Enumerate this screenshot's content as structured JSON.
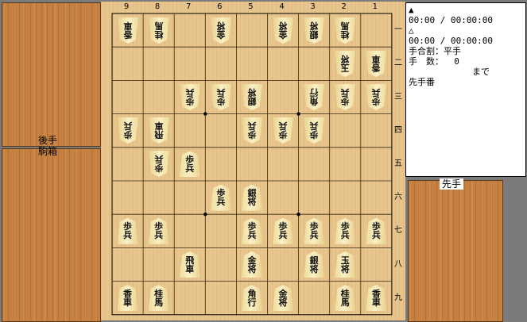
{
  "board": {
    "files": [
      "9",
      "8",
      "7",
      "6",
      "5",
      "4",
      "3",
      "2",
      "1"
    ],
    "ranks": [
      "一",
      "二",
      "三",
      "四",
      "五",
      "六",
      "七",
      "八",
      "九"
    ],
    "hoshi": [
      [
        3,
        3
      ],
      [
        6,
        3
      ],
      [
        3,
        6
      ],
      [
        6,
        6
      ]
    ],
    "pieces": [
      {
        "file": 9,
        "rank": 1,
        "text": "香車",
        "side": "gote"
      },
      {
        "file": 8,
        "rank": 1,
        "text": "桂馬",
        "side": "gote"
      },
      {
        "file": 6,
        "rank": 1,
        "text": "金将",
        "side": "gote"
      },
      {
        "file": 4,
        "rank": 1,
        "text": "金将",
        "side": "gote"
      },
      {
        "file": 3,
        "rank": 1,
        "text": "銀将",
        "side": "gote"
      },
      {
        "file": 2,
        "rank": 1,
        "text": "桂馬",
        "side": "gote"
      },
      {
        "file": 2,
        "rank": 2,
        "text": "玉将",
        "side": "gote"
      },
      {
        "file": 1,
        "rank": 2,
        "text": "香車",
        "side": "gote"
      },
      {
        "file": 7,
        "rank": 3,
        "text": "歩兵",
        "side": "gote"
      },
      {
        "file": 6,
        "rank": 3,
        "text": "歩兵",
        "side": "gote"
      },
      {
        "file": 5,
        "rank": 3,
        "text": "銀将",
        "side": "gote"
      },
      {
        "file": 3,
        "rank": 3,
        "text": "角行",
        "side": "gote"
      },
      {
        "file": 2,
        "rank": 3,
        "text": "歩兵",
        "side": "gote"
      },
      {
        "file": 1,
        "rank": 3,
        "text": "歩兵",
        "side": "gote"
      },
      {
        "file": 9,
        "rank": 4,
        "text": "歩兵",
        "side": "gote"
      },
      {
        "file": 8,
        "rank": 4,
        "text": "飛車",
        "side": "gote"
      },
      {
        "file": 5,
        "rank": 4,
        "text": "歩兵",
        "side": "gote"
      },
      {
        "file": 4,
        "rank": 4,
        "text": "歩兵",
        "side": "gote"
      },
      {
        "file": 3,
        "rank": 4,
        "text": "歩兵",
        "side": "gote"
      },
      {
        "file": 8,
        "rank": 5,
        "text": "歩兵",
        "side": "gote"
      },
      {
        "file": 7,
        "rank": 5,
        "text": "歩兵",
        "side": "sente"
      },
      {
        "file": 6,
        "rank": 6,
        "text": "歩兵",
        "side": "sente"
      },
      {
        "file": 5,
        "rank": 6,
        "text": "銀将",
        "side": "sente"
      },
      {
        "file": 9,
        "rank": 7,
        "text": "歩兵",
        "side": "sente"
      },
      {
        "file": 8,
        "rank": 7,
        "text": "歩兵",
        "side": "sente"
      },
      {
        "file": 5,
        "rank": 7,
        "text": "歩兵",
        "side": "sente"
      },
      {
        "file": 4,
        "rank": 7,
        "text": "歩兵",
        "side": "sente"
      },
      {
        "file": 3,
        "rank": 7,
        "text": "歩兵",
        "side": "sente"
      },
      {
        "file": 2,
        "rank": 7,
        "text": "歩兵",
        "side": "sente"
      },
      {
        "file": 1,
        "rank": 7,
        "text": "歩兵",
        "side": "sente"
      },
      {
        "file": 7,
        "rank": 8,
        "text": "飛車",
        "side": "sente"
      },
      {
        "file": 5,
        "rank": 8,
        "text": "金将",
        "side": "sente"
      },
      {
        "file": 3,
        "rank": 8,
        "text": "銀将",
        "side": "sente"
      },
      {
        "file": 2,
        "rank": 8,
        "text": "玉将",
        "side": "sente"
      },
      {
        "file": 9,
        "rank": 9,
        "text": "香車",
        "side": "sente"
      },
      {
        "file": 8,
        "rank": 9,
        "text": "桂馬",
        "side": "sente"
      },
      {
        "file": 5,
        "rank": 9,
        "text": "角行",
        "side": "sente"
      },
      {
        "file": 4,
        "rank": 9,
        "text": "金将",
        "side": "sente"
      },
      {
        "file": 2,
        "rank": 9,
        "text": "桂馬",
        "side": "sente"
      },
      {
        "file": 1,
        "rank": 9,
        "text": "香車",
        "side": "sente"
      }
    ]
  },
  "gote_komadai": {
    "label_line1": "後手",
    "label_line2": "駒箱"
  },
  "sente_komadai": {
    "label": "先手"
  },
  "info": {
    "sente_mark": "▲",
    "sente_time": "00:00 / 00:00:00",
    "gote_mark": "△",
    "gote_time": "00:00 / 00:00:00",
    "handicap": "手合割：平手",
    "moves": "手　数：  0",
    "made": "まで",
    "turn": "先手番"
  },
  "colors": {
    "board": "#e7c58c",
    "komadai": "#c6803f",
    "piece": "#f6e7b0",
    "grid": "#000000"
  }
}
